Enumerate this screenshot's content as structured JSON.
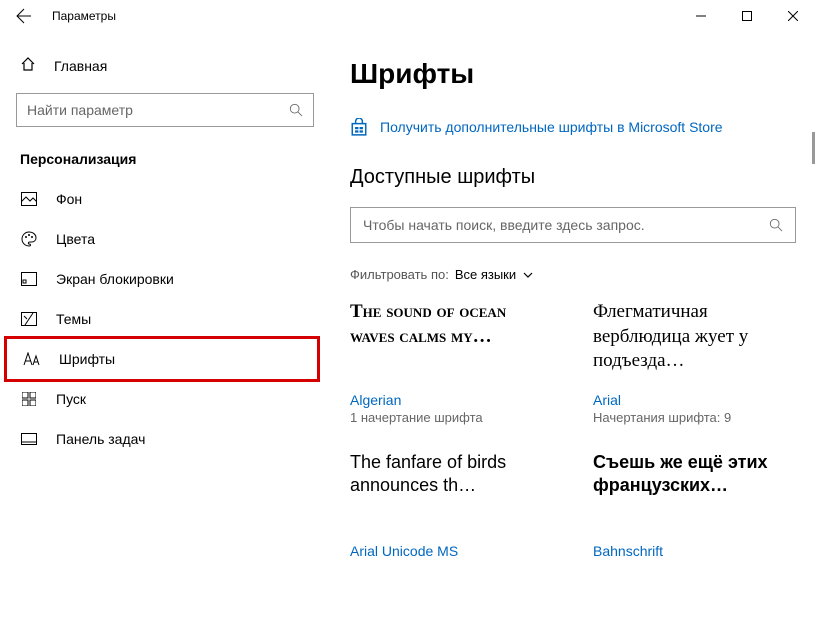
{
  "titlebar": {
    "title": "Параметры"
  },
  "sidebar": {
    "home": "Главная",
    "search_placeholder": "Найти параметр",
    "section": "Персонализация",
    "items": [
      {
        "label": "Фон"
      },
      {
        "label": "Цвета"
      },
      {
        "label": "Экран блокировки"
      },
      {
        "label": "Темы"
      },
      {
        "label": "Шрифты"
      },
      {
        "label": "Пуск"
      },
      {
        "label": "Панель задач"
      }
    ]
  },
  "main": {
    "heading": "Шрифты",
    "store_link": "Получить дополнительные шрифты в Microsoft Store",
    "available": "Доступные шрифты",
    "font_search_placeholder": "Чтобы начать поиск, введите здесь запрос.",
    "filter_label": "Фильтровать по:",
    "filter_value": "Все языки",
    "fonts": [
      {
        "sample": "The sound of ocean waves calms my…",
        "name": "Algerian",
        "meta": "1 начертание шрифта"
      },
      {
        "sample": "Флегматичная верблюдица жует у подъезда…",
        "name": "Arial",
        "meta": "Начертания шрифта: 9"
      },
      {
        "sample": "The fanfare of birds announces th…",
        "name": "Arial Unicode MS",
        "meta": ""
      },
      {
        "sample": "Съешь же ещё этих французских…",
        "name": "Bahnschrift",
        "meta": ""
      }
    ]
  }
}
